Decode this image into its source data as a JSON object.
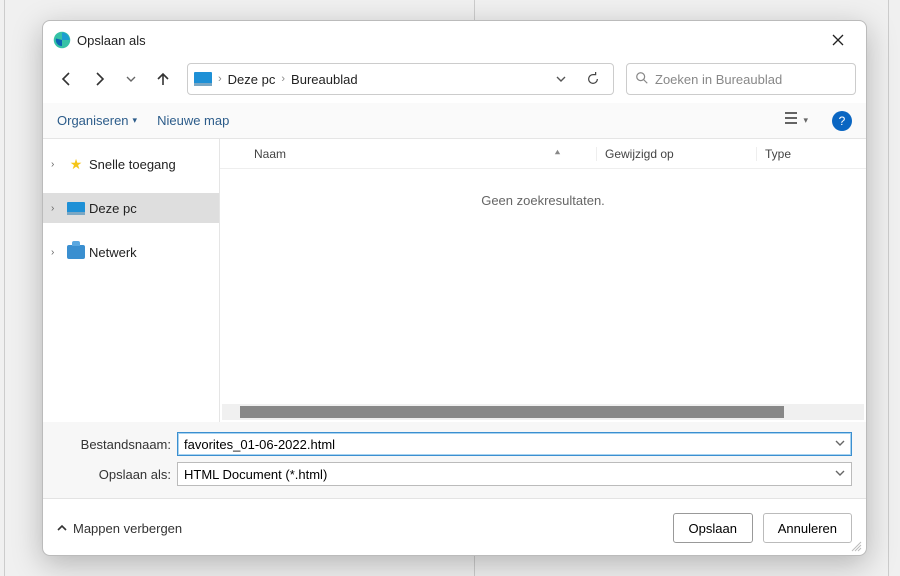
{
  "window": {
    "title": "Opslaan als"
  },
  "breadcrumbs": {
    "root": "Deze pc",
    "current": "Bureaublad"
  },
  "search": {
    "placeholder": "Zoeken in Bureaublad"
  },
  "toolbar": {
    "organize": "Organiseren",
    "new_folder": "Nieuwe map"
  },
  "tree": {
    "quick_access": "Snelle toegang",
    "this_pc": "Deze pc",
    "network": "Netwerk"
  },
  "columns": {
    "name": "Naam",
    "modified": "Gewijzigd op",
    "type": "Type"
  },
  "empty_message": "Geen zoekresultaten.",
  "fields": {
    "filename_label": "Bestandsnaam:",
    "filetype_label": "Opslaan als:",
    "filename_value": "favorites_01-06-2022.html",
    "filetype_value": "HTML Document (*.html)"
  },
  "footer": {
    "hide_folders": "Mappen verbergen",
    "save": "Opslaan",
    "cancel": "Annuleren"
  }
}
